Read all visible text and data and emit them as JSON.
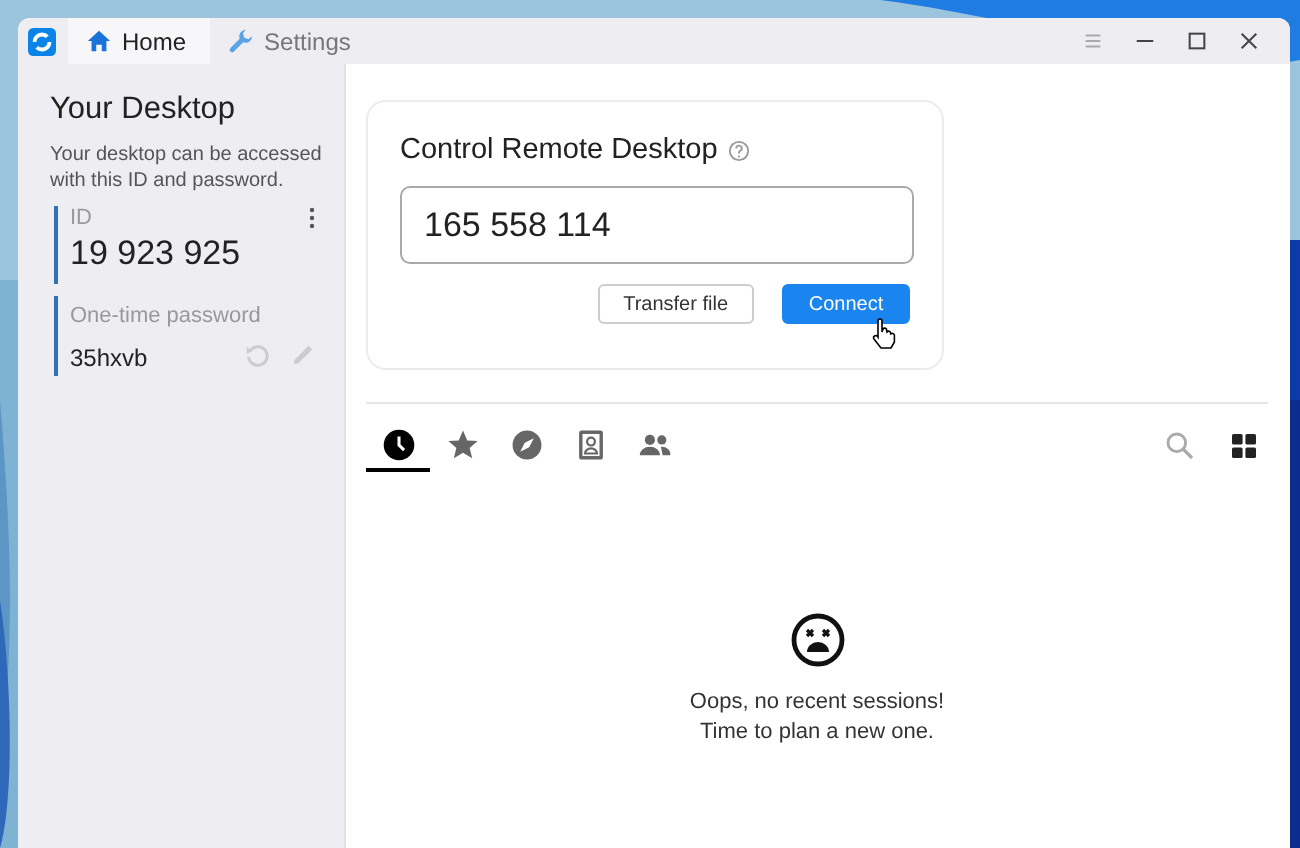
{
  "window": {
    "tabs": [
      {
        "label": "Home",
        "kind": "home",
        "selected": true
      },
      {
        "label": "Settings",
        "kind": "settings",
        "selected": false
      }
    ]
  },
  "sidebar": {
    "title": "Your Desktop",
    "description": "Your desktop can be accessed with this ID and password.",
    "id_label": "ID",
    "id_value": "19 923 925",
    "password_label": "One-time password",
    "password_value": "35hxvb"
  },
  "remote": {
    "title": "Control Remote Desktop",
    "id_value": "165 558 114",
    "buttons": [
      {
        "label": "Transfer file",
        "kind": "secondary"
      },
      {
        "label": "Connect",
        "kind": "primary"
      }
    ]
  },
  "session_tabs": [
    {
      "kind": "recent",
      "selected": true
    },
    {
      "kind": "favorites",
      "selected": false
    },
    {
      "kind": "discovered",
      "selected": false
    },
    {
      "kind": "address-book",
      "selected": false
    },
    {
      "kind": "group",
      "selected": false
    }
  ],
  "empty_state": {
    "message": "Oops, no recent sessions!\nTime to plan a new one."
  }
}
